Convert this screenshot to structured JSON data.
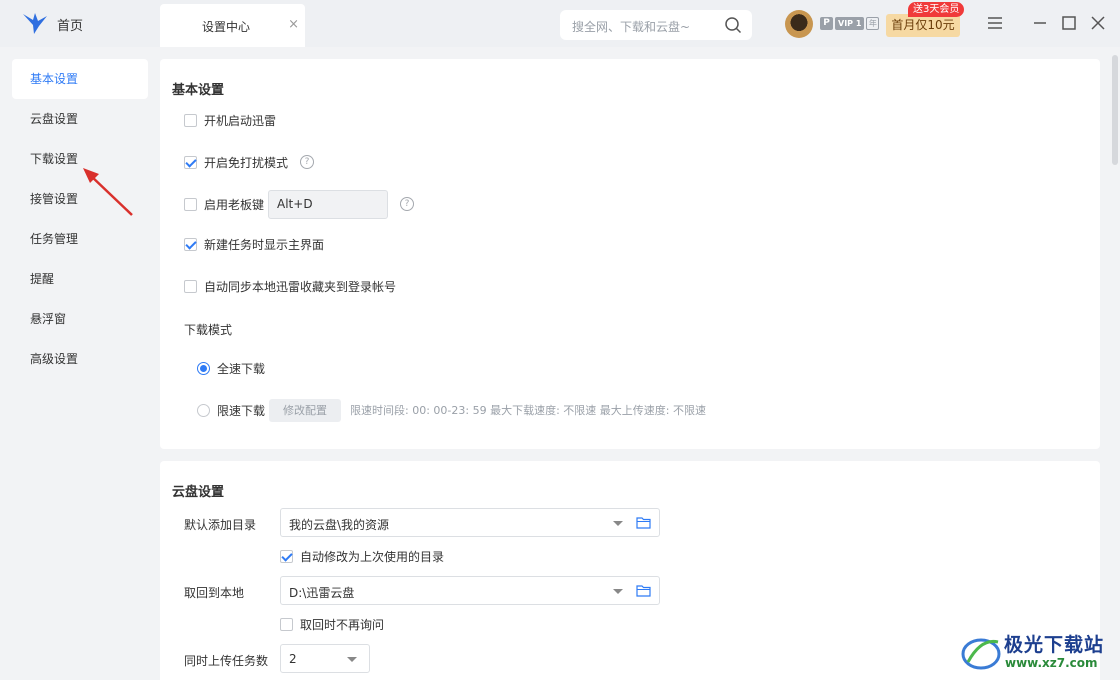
{
  "titlebar": {
    "home_label": "首页",
    "tab_label": "设置中心",
    "tab_close": "×",
    "search_placeholder": "搜全网、下载和云盘~",
    "vip_p": "P",
    "vip_level": "VIP 1",
    "vip_year": "年",
    "promo_badge": "送3天会员",
    "promo_button": "首月仅10元"
  },
  "sidebar": {
    "items": [
      {
        "label": "基本设置",
        "active": true
      },
      {
        "label": "云盘设置"
      },
      {
        "label": "下载设置"
      },
      {
        "label": "接管设置"
      },
      {
        "label": "任务管理"
      },
      {
        "label": "提醒"
      },
      {
        "label": "悬浮窗"
      },
      {
        "label": "高级设置"
      }
    ]
  },
  "basic": {
    "title": "基本设置",
    "autostart": "开机启动迅雷",
    "dnd_mode": "开启免打扰模式",
    "boss_key": "启用老板键",
    "boss_key_value": "Alt+D",
    "show_main": "新建任务时显示主界面",
    "sync_fav": "自动同步本地迅雷收藏夹到登录帐号",
    "download_mode_label": "下载模式",
    "full_speed": "全速下载",
    "limited": "限速下载",
    "modify_btn": "修改配置",
    "limit_info": "限速时间段:   00: 00-23: 59   最大下载速度: 不限速    最大上传速度: 不限速",
    "help_glyph": "?"
  },
  "cloud": {
    "title": "云盘设置",
    "default_dir_label": "默认添加目录",
    "default_dir_value": "我的云盘\\我的资源",
    "auto_modify": "自动修改为上次使用的目录",
    "retrieve_label": "取回到本地",
    "retrieve_value": "D:\\迅雷云盘",
    "no_ask": "取回时不再询问",
    "upload_label": "同时上传任务数",
    "upload_value": "2"
  },
  "watermark": {
    "line1": "极光下载站",
    "line2": "www.xz7.com"
  },
  "colors": {
    "accent": "#2f7bf5",
    "arrow": "#d9302c"
  }
}
